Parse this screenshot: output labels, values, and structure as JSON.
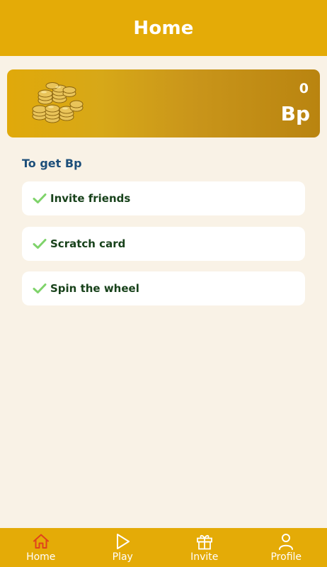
{
  "header": {
    "title": "Home"
  },
  "balance": {
    "value": "0",
    "unit": "Bp",
    "icon": "coins-icon"
  },
  "earn": {
    "title": "To get Bp",
    "tasks": [
      {
        "label": "Invite friends",
        "icon": "check-icon"
      },
      {
        "label": "Scratch card",
        "icon": "check-icon"
      },
      {
        "label": "Spin the wheel",
        "icon": "check-icon"
      }
    ]
  },
  "nav": {
    "items": [
      {
        "label": "Home",
        "icon": "home-icon",
        "active": true
      },
      {
        "label": "Play",
        "icon": "play-icon",
        "active": false
      },
      {
        "label": "Invite",
        "icon": "gift-icon",
        "active": false
      },
      {
        "label": "Profile",
        "icon": "profile-icon",
        "active": false
      }
    ]
  },
  "colors": {
    "primary": "#e4ab07",
    "background": "#f9f2e6",
    "check": "#7fd36b",
    "task_text": "#18421b",
    "section_title": "#1d4f7a",
    "active_nav_icon": "#e0421c"
  }
}
